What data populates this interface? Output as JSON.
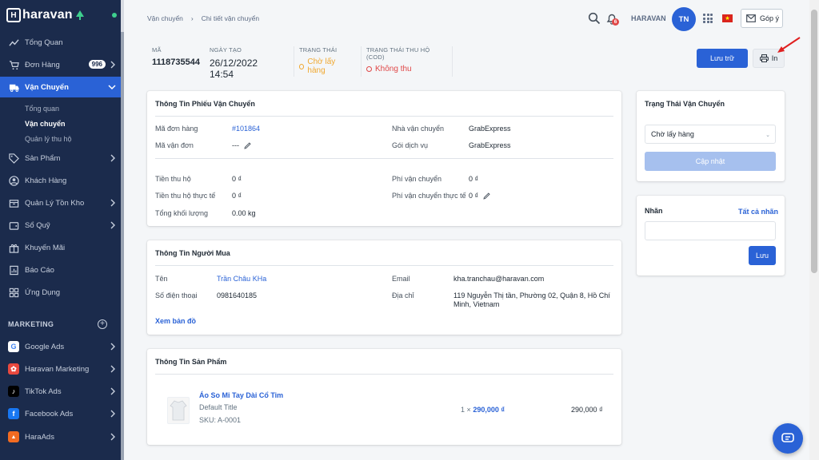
{
  "brand": {
    "logo_letter": "H",
    "logo_text": "haravan"
  },
  "sidebar": {
    "items": [
      {
        "label": "Tổng Quan",
        "icon": "trend-icon"
      },
      {
        "label": "Đơn Hàng",
        "icon": "cart-icon",
        "badge": "996"
      },
      {
        "label": "Vận Chuyển",
        "icon": "truck-icon"
      },
      {
        "label": "Sản Phẩm",
        "icon": "tag-icon"
      },
      {
        "label": "Khách Hàng",
        "icon": "user-icon"
      },
      {
        "label": "Quản Lý Tồn Kho",
        "icon": "box-icon"
      },
      {
        "label": "Sổ Quỹ",
        "icon": "wallet-icon"
      },
      {
        "label": "Khuyến Mãi",
        "icon": "gift-icon"
      },
      {
        "label": "Báo Cáo",
        "icon": "report-icon"
      },
      {
        "label": "Ứng Dụng",
        "icon": "apps-icon"
      }
    ],
    "sub_items": [
      "Tổng quan",
      "Vận chuyển",
      "Quản lý thu hộ"
    ],
    "marketing_title": "MARKETING",
    "marketing_add": "+",
    "apps": [
      {
        "label": "Google Ads",
        "glyph": "G",
        "color": "#ffffff"
      },
      {
        "label": "Haravan Marketing",
        "glyph": "✿",
        "color": "#e8493f"
      },
      {
        "label": "TikTok Ads",
        "glyph": "♪",
        "color": "#000000"
      },
      {
        "label": "Facebook Ads",
        "glyph": "f",
        "color": "#1877f2"
      },
      {
        "label": "HaraAds",
        "glyph": "▲",
        "color": "#f26b21"
      }
    ]
  },
  "topbar": {
    "breadcrumb": [
      "Vận chuyển",
      "›",
      "Chi tiết vận chuyển"
    ],
    "notification_count": "6",
    "store_name": "HARAVAN",
    "avatar_initials": "TN",
    "feedback_label": "Góp ý"
  },
  "summary": {
    "code_label": "MÃ",
    "code": "1118735544",
    "created_label": "NGÀY TẠO",
    "created": "26/12/2022 14:54",
    "status_label": "TRẠNG THÁI",
    "status": "Chờ lấy hàng",
    "cod_label": "TRẠNG THÁI THU HỘ (COD)",
    "cod_status": "Không thu"
  },
  "actions": {
    "save": "Lưu trữ",
    "print": "In"
  },
  "shipment": {
    "title": "Thông Tin Phiếu Vận Chuyển",
    "order_label": "Mã đơn hàng",
    "order": "#101864",
    "waybill_label": "Mã vận đơn",
    "waybill": "---",
    "carrier_label": "Nhà vận chuyển",
    "carrier": "GrabExpress",
    "service_label": "Gói dịch vụ",
    "service": "GrabExpress",
    "cod_label": "Tiền thu hộ",
    "cod": "0 ₫",
    "cod_actual_label": "Tiền thu hộ thực tế",
    "cod_actual": "0 ₫",
    "weight_label": "Tổng khối lượng",
    "weight": "0.00 kg",
    "fee_label": "Phí vận chuyển",
    "fee": "0 ₫",
    "fee_actual_label": "Phí vận chuyển thực tế",
    "fee_actual": "0 ₫"
  },
  "buyer": {
    "title": "Thông Tin Người Mua",
    "name_label": "Tên",
    "name": "Trần Châu KHa",
    "phone_label": "Số điện thoại",
    "phone": "0981640185",
    "email_label": "Email",
    "email": "kha.tranchau@haravan.com",
    "address_label": "Địa chỉ",
    "address_line1": "119 Nguyễn Thị tần, Phường 02, Quận 8, Hồ Chí",
    "address_line2": "Minh, Vietnam",
    "map_link": "Xem bản đồ"
  },
  "product": {
    "title": "Thông Tin Sản Phẩm",
    "name": "Áo So Mi Tay Dài Cổ Tim",
    "variant": "Default Title",
    "sku": "SKU: A-0001",
    "qty": "1",
    "times": "×",
    "price": "290,000 ₫",
    "total": "290,000 ₫"
  },
  "status_panel": {
    "title": "Trạng Thái Vận Chuyển",
    "selected": "Chờ lấy hàng",
    "update": "Cập nhật"
  },
  "label_panel": {
    "title": "Nhãn",
    "all_link": "Tất cả nhãn",
    "save": "Lưu"
  },
  "colors": {
    "primary": "#2a62d6",
    "sidebar": "#1b2b4c",
    "pending": "#f0a830",
    "no_cod": "#e04848"
  }
}
